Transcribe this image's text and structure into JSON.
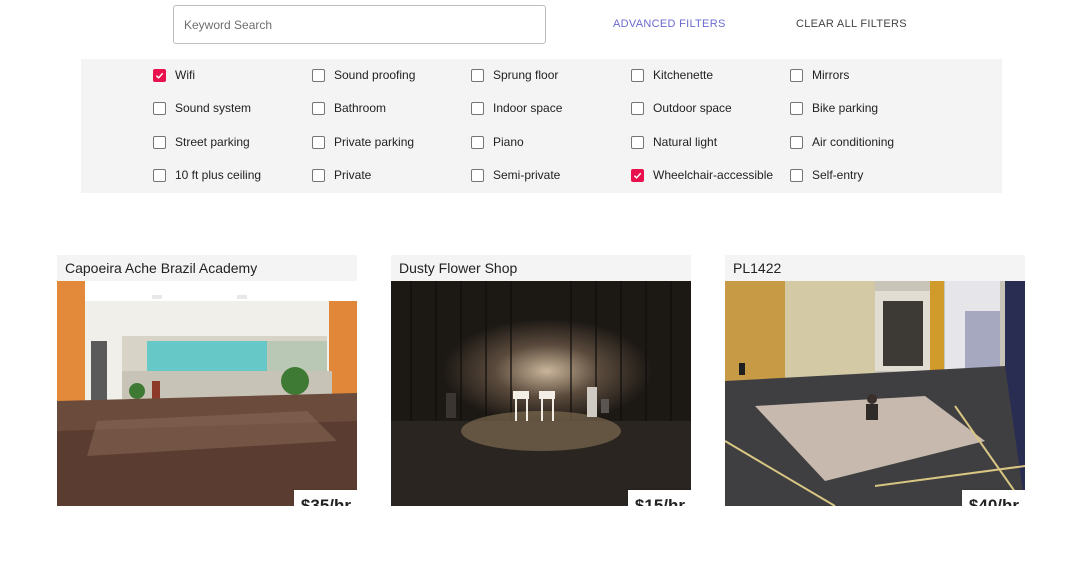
{
  "search": {
    "placeholder": "Keyword Search",
    "value": ""
  },
  "links": {
    "advanced": "ADVANCED FILTERS",
    "clear": "CLEAR ALL FILTERS"
  },
  "accent_color": "#e8114d",
  "link_color": "#6a6ad0",
  "filters": [
    {
      "label": "Wifi",
      "checked": true
    },
    {
      "label": "Sound proofing",
      "checked": false
    },
    {
      "label": "Sprung floor",
      "checked": false
    },
    {
      "label": "Kitchenette",
      "checked": false
    },
    {
      "label": "Mirrors",
      "checked": false
    },
    {
      "label": "Sound system",
      "checked": false
    },
    {
      "label": "Bathroom",
      "checked": false
    },
    {
      "label": "Indoor space",
      "checked": false
    },
    {
      "label": "Outdoor space",
      "checked": false
    },
    {
      "label": "Bike parking",
      "checked": false
    },
    {
      "label": "Street parking",
      "checked": false
    },
    {
      "label": "Private parking",
      "checked": false
    },
    {
      "label": "Piano",
      "checked": false
    },
    {
      "label": "Natural light",
      "checked": false
    },
    {
      "label": "Air conditioning",
      "checked": false
    },
    {
      "label": "10 ft plus ceiling",
      "checked": false
    },
    {
      "label": "Private",
      "checked": false
    },
    {
      "label": "Semi-private",
      "checked": false
    },
    {
      "label": "Wheelchair-accessible",
      "checked": true
    },
    {
      "label": "Self-entry",
      "checked": false
    }
  ],
  "listings": [
    {
      "title": "Capoeira Ache Brazil Academy",
      "price": "$35/hr"
    },
    {
      "title": "Dusty Flower Shop",
      "price": "$15/hr"
    },
    {
      "title": "PL1422",
      "price": "$40/hr"
    }
  ]
}
